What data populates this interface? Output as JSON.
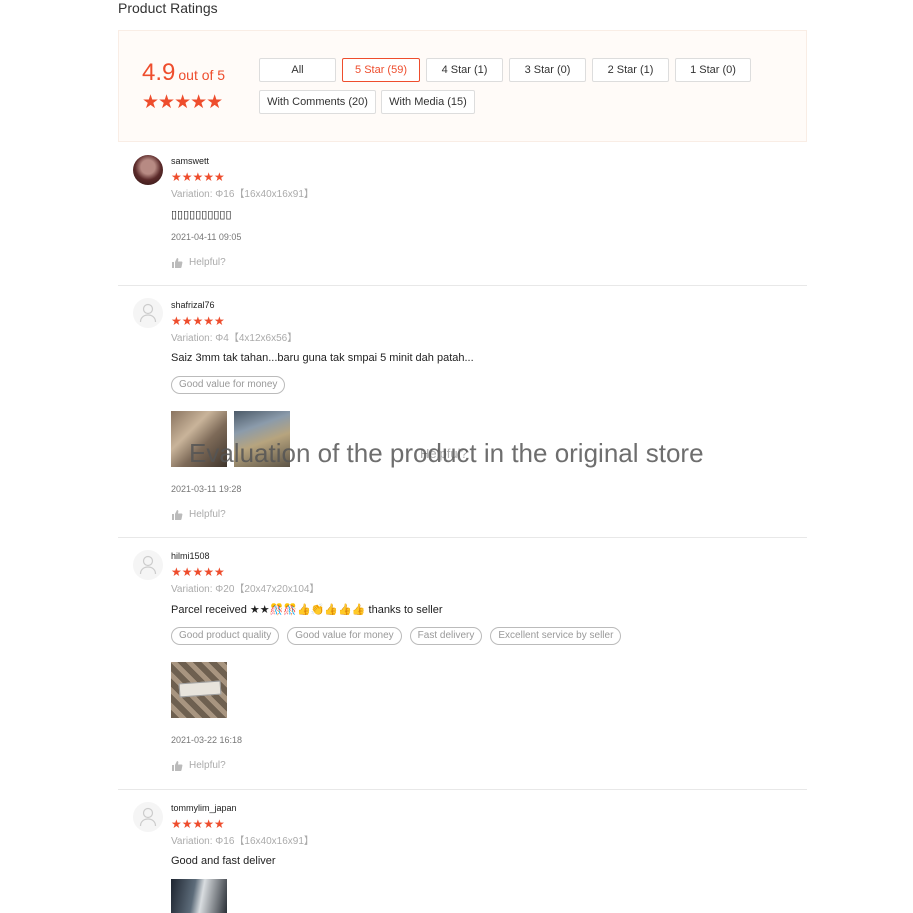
{
  "section_title": "Product Ratings",
  "overview": {
    "score": "4.9",
    "score_suffix": "out of 5",
    "stars": "★★★★★",
    "filters": [
      {
        "label": "All",
        "active": false
      },
      {
        "label": "5 Star (59)",
        "active": true
      },
      {
        "label": "4 Star (1)",
        "active": false
      },
      {
        "label": "3 Star (0)",
        "active": false
      },
      {
        "label": "2 Star (1)",
        "active": false
      },
      {
        "label": "1 Star (0)",
        "active": false
      },
      {
        "label": "With Comments (20)",
        "active": false
      },
      {
        "label": "With Media (15)",
        "active": false
      }
    ]
  },
  "reviews": [
    {
      "username": "samswett",
      "stars": "★★★★★",
      "variation": "Variation: Φ16【16x40x16x91】",
      "comment": "▯▯▯▯▯▯▯▯▯▯",
      "date": "2021-04-11 09:05",
      "helpful": "Helpful?",
      "avatar": "photo"
    },
    {
      "username": "shafrizal76",
      "stars": "★★★★★",
      "variation": "Variation: Φ4【4x12x6x56】",
      "comment": "Saiz 3mm tak tahan...baru guna tak smpai 5 minit dah patah...",
      "tags": [
        "Good value for money"
      ],
      "date": "2021-03-11 19:28",
      "helpful": "Helpful?",
      "avatar": "default"
    },
    {
      "username": "hilmi1508",
      "stars": "★★★★★",
      "variation": "Variation: Φ20【20x47x20x104】",
      "comment": "Parcel received ★★🎊🎊👍👏👍👍👍 thanks to seller",
      "tags": [
        "Good product quality",
        "Good value for money",
        "Fast delivery",
        "Excellent service by seller"
      ],
      "date": "2021-03-22 16:18",
      "helpful": "Helpful?",
      "avatar": "default"
    },
    {
      "username": "tommylim_japan",
      "stars": "★★★★★",
      "variation": "Variation: Φ16【16x40x16x91】",
      "comment": "Good and fast deliver",
      "avatar": "default"
    }
  ],
  "watermark": "Evaluation of the product in the original store",
  "overlay_text": "Helpful?",
  "colors": {
    "accent": "#ee4d2d",
    "panel_bg": "#fffbf8"
  },
  "icons": {
    "avatar": "user-icon",
    "helpful": "thumbs-up-icon"
  }
}
